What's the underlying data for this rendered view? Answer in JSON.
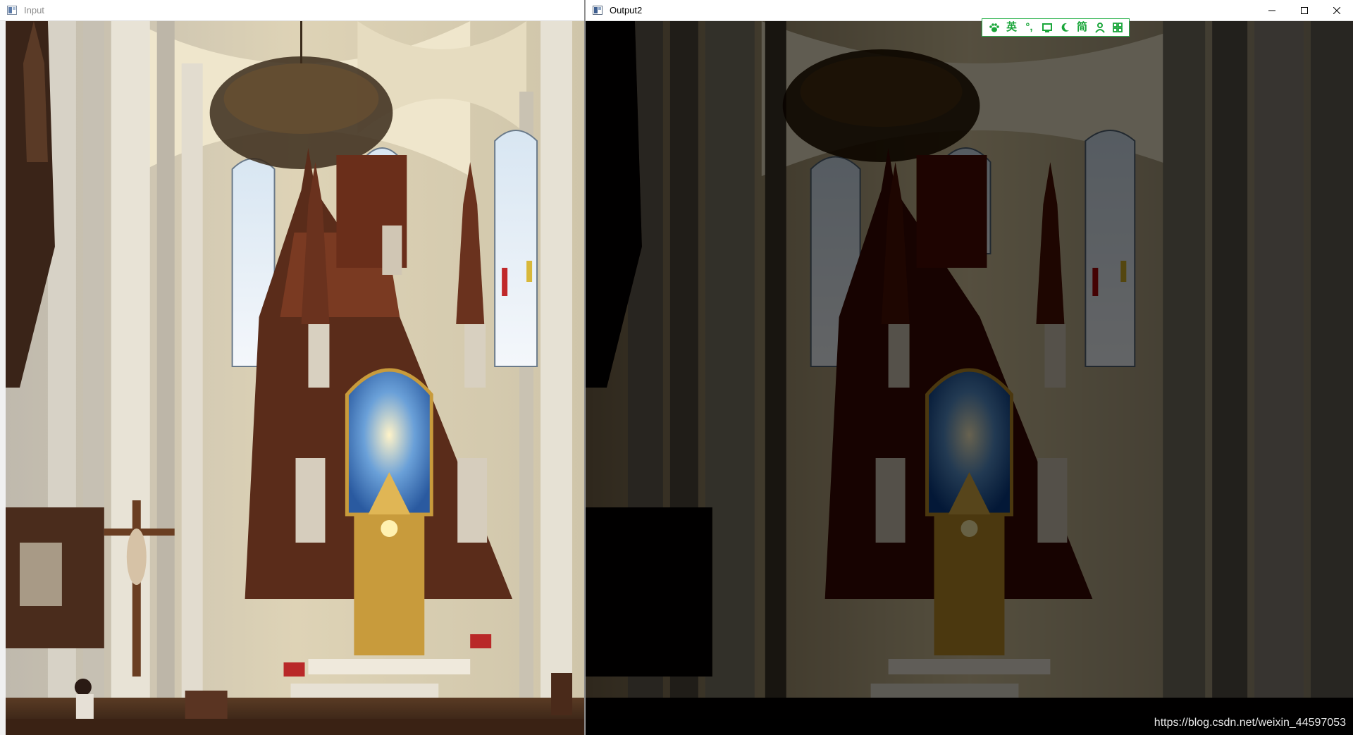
{
  "windows": {
    "input": {
      "title": "Input",
      "app_icon": "opencv-window-icon"
    },
    "output": {
      "title": "Output2",
      "app_icon": "opencv-window-icon",
      "controls": {
        "minimize": "minimize-icon",
        "maximize": "maximize-icon",
        "close": "close-icon"
      }
    }
  },
  "ime_toolbar": {
    "items": [
      {
        "icon": "paw-icon",
        "label": ""
      },
      {
        "icon": "language-toggle",
        "label": "英"
      },
      {
        "icon": "punctuation-icon",
        "label": "°,"
      },
      {
        "icon": "keyboard-icon",
        "label": ""
      },
      {
        "icon": "moon-icon",
        "label": ""
      },
      {
        "icon": "simplified-toggle",
        "label": "简"
      },
      {
        "icon": "user-icon",
        "label": ""
      },
      {
        "icon": "grid-icon",
        "label": ""
      }
    ],
    "accent_color": "#1aa63a"
  },
  "watermark": {
    "text": "https://blog.csdn.net/weixin_44597053"
  },
  "scene": {
    "description_color_wall": "#d9cba6",
    "accent_gold": "#c89b3c"
  }
}
